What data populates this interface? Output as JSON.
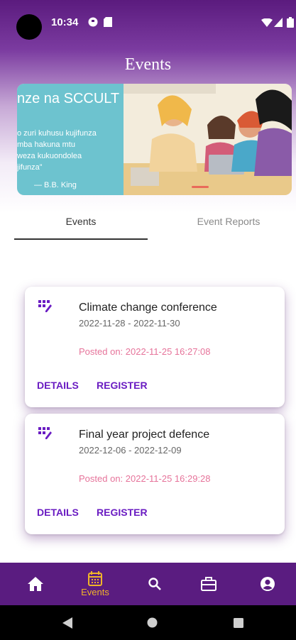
{
  "status_bar": {
    "time": "10:34",
    "icons": [
      "gpay-icon",
      "sim-card-icon",
      "wifi-icon",
      "signal-icon",
      "battery-icon"
    ]
  },
  "header": {
    "title": "Events"
  },
  "banner": {
    "heading": "nze na SCCULT",
    "quote": "o zuri kuhusu kujifunza\nmba hakuna mtu\nweza kukuondolea\njifunza”",
    "author": "— B.B. King"
  },
  "tabs": [
    {
      "label": "Events",
      "selected": true
    },
    {
      "label": "Event Reports",
      "selected": false
    }
  ],
  "events": [
    {
      "title": "Climate change conference",
      "dates": "2022-11-28 - 2022-11-30",
      "posted": "Posted on: 2022-11-25 16:27:08",
      "details_label": "DETAILS",
      "register_label": "REGISTER"
    },
    {
      "title": "Final year project defence",
      "dates": "2022-12-06 - 2022-12-09",
      "posted": "Posted on: 2022-11-25 16:29:28",
      "details_label": "DETAILS",
      "register_label": "REGISTER"
    }
  ],
  "bottom_nav": {
    "items": [
      {
        "icon": "home-icon",
        "label": ""
      },
      {
        "icon": "calendar-icon",
        "label": "Events",
        "active": true
      },
      {
        "icon": "search-icon",
        "label": ""
      },
      {
        "icon": "briefcase-icon",
        "label": ""
      },
      {
        "icon": "account-icon",
        "label": ""
      }
    ],
    "active_color": "#f0b429"
  },
  "colors": {
    "primary": "#5a1c80",
    "accent": "#6a1cc2",
    "posted_text": "#e6739a"
  }
}
